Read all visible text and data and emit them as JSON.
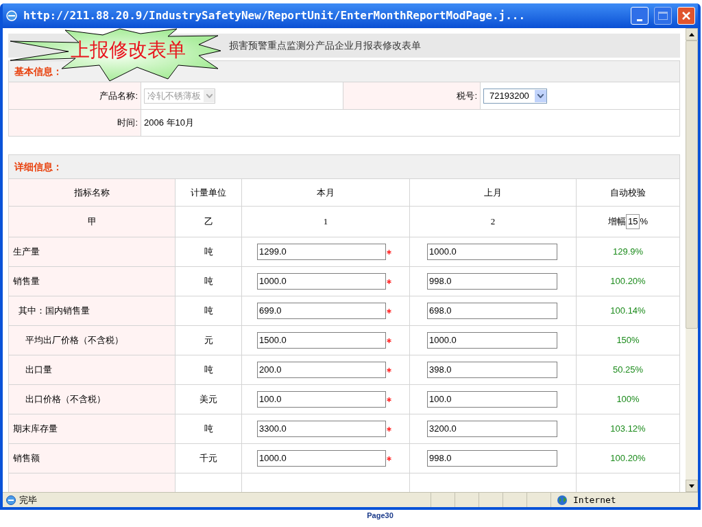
{
  "window": {
    "title": "http://211.88.20.9/IndustrySafetyNew/ReportUnit/EnterMonthReportModPage.j..."
  },
  "callout": {
    "text": "上报修改表单"
  },
  "page_title": "损害预警重点监测分产品企业月报表修改表单",
  "basic_info": {
    "heading": "基本信息：",
    "product_label": "产品名称:",
    "product_value": "冷轧不锈薄板",
    "product_disabled": true,
    "tax_label": "税号:",
    "tax_value": "72193200",
    "time_label": "时间:",
    "time_value": "2006 年10月"
  },
  "detail": {
    "heading": "详细信息：",
    "columns": [
      "指标名称",
      "计量单位",
      "本月",
      "上月",
      "自动校验"
    ],
    "index_row": [
      "甲",
      "乙",
      "1",
      "2"
    ],
    "growth_label": "增幅",
    "growth_value": "15",
    "growth_unit": "%",
    "rows": [
      {
        "name": "生产量",
        "unit": "吨",
        "this_month": "1299.0",
        "required": true,
        "last_month": "1000.0",
        "check": "129.9%"
      },
      {
        "name": "销售量",
        "unit": "吨",
        "this_month": "1000.0",
        "required": true,
        "last_month": "998.0",
        "check": "100.20%",
        "children": [
          {
            "name": "其中：国内销售量",
            "unit": "吨",
            "this_month": "699.0",
            "required": true,
            "last_month": "698.0",
            "check": "100.14%",
            "children": [
              {
                "name": "平均出厂价格（不含税）",
                "unit": "元",
                "this_month": "1500.0",
                "required": true,
                "last_month": "1000.0",
                "check": "150%"
              },
              {
                "name": "出口量",
                "unit": "吨",
                "this_month": "200.0",
                "required": true,
                "last_month": "398.0",
                "check": "50.25%"
              },
              {
                "name": "出口价格（不含税）",
                "unit": "美元",
                "this_month": "100.0",
                "required": true,
                "last_month": "100.0",
                "check": "100%"
              }
            ]
          }
        ]
      },
      {
        "name": "期末库存量",
        "unit": "吨",
        "this_month": "3300.0",
        "required": true,
        "last_month": "3200.0",
        "check": "103.12%"
      },
      {
        "name": "销售额",
        "unit": "千元",
        "this_month": "1000.0",
        "required": true,
        "last_month": "998.0",
        "check": "100.20%"
      }
    ]
  },
  "status_bar": {
    "text": "完毕",
    "zone": "Internet"
  },
  "page_label": "Page30"
}
